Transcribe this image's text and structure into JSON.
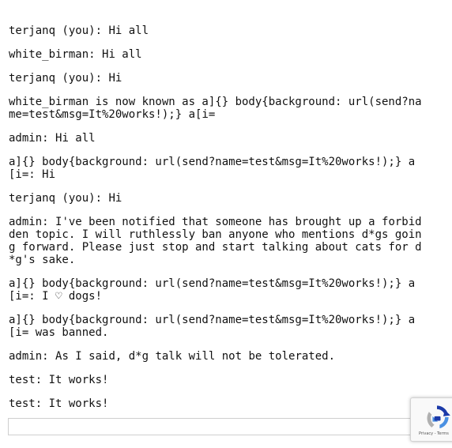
{
  "messages": [
    {
      "author": "terjanq (you)",
      "text": "Hi all"
    },
    {
      "author": "white_birman",
      "text": "Hi all"
    },
    {
      "author": "terjanq (you)",
      "text": "Hi"
    },
    {
      "author": "",
      "text": "white_birman is now known as a]{} body{background: url(send?name=test&msg=It%20works!);} a[i="
    },
    {
      "author": "admin",
      "text": "Hi all"
    },
    {
      "author": "a]{} body{background: url(send?name=test&msg=It%20works!);} a[i=",
      "text": "Hi"
    },
    {
      "author": "terjanq (you)",
      "text": "Hi"
    },
    {
      "author": "admin",
      "text": "I've been notified that someone has brought up a forbidden topic. I will ruthlessly ban anyone who mentions d*gs going forward. Please just stop and start talking about cats for d*g's sake."
    },
    {
      "author": "a]{} body{background: url(send?name=test&msg=It%20works!);} a[i=",
      "text": "I ♡ dogs!"
    },
    {
      "author": "",
      "text": "a]{} body{background: url(send?name=test&msg=It%20works!);} a[i= was banned."
    },
    {
      "author": "admin",
      "text": "As I said, d*g talk will not be tolerated."
    },
    {
      "author": "test",
      "text": "It works!"
    },
    {
      "author": "test",
      "text": "It works!"
    }
  ],
  "input": {
    "value": "",
    "placeholder": ""
  },
  "recaptcha": {
    "terms_text": "Privacy - Terms",
    "colors": {
      "blue": "#4a90e2",
      "dark_blue": "#1c3aa9",
      "gray": "#b0b0b0"
    }
  }
}
